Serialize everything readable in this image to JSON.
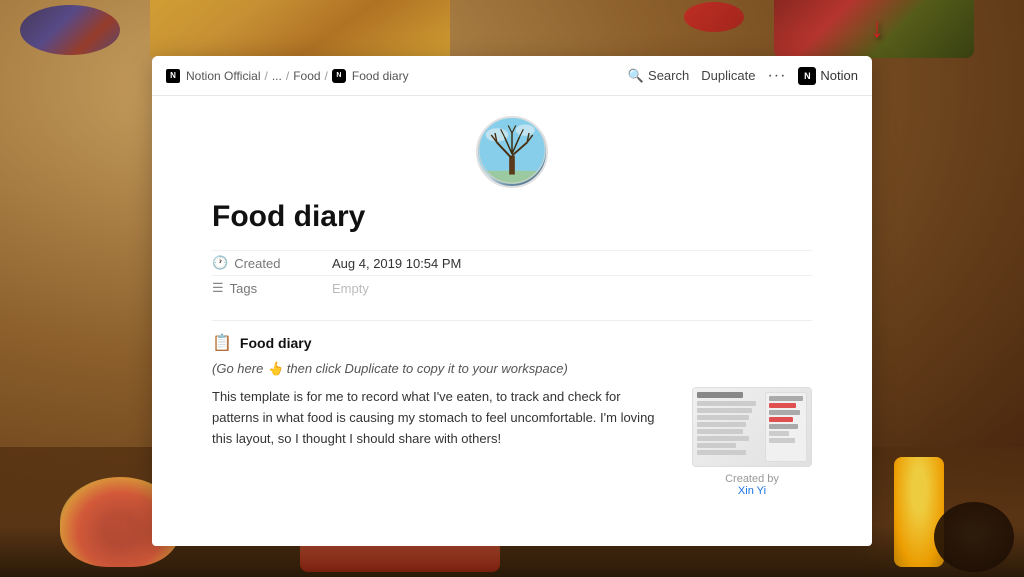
{
  "background": {
    "alt": "Food background image"
  },
  "arrow": {
    "symbol": "↓",
    "color": "#cc2222"
  },
  "topbar": {
    "notion_icon": "N",
    "breadcrumb": [
      {
        "label": "Notion Official",
        "href": "#"
      },
      {
        "label": "...",
        "href": "#"
      },
      {
        "label": "Food",
        "href": "#"
      },
      {
        "label": "Food diary",
        "href": "#"
      }
    ],
    "search_label": "Search",
    "duplicate_label": "Duplicate",
    "more_label": "···",
    "notion_label": "Notion"
  },
  "page": {
    "avatar_alt": "Tree in winter against blue sky",
    "title": "Food diary",
    "meta": {
      "created_label": "Created",
      "created_value": "Aug 4, 2019 10:54 PM",
      "tags_label": "Tags",
      "tags_value": "Empty"
    },
    "section": {
      "icon": "📋",
      "heading": "Food diary",
      "subtitle_pre": "(Go here",
      "subtitle_hand": "👆",
      "subtitle_post": "then click Duplicate to copy it to your workspace)",
      "description": "This template is for me to record what I've eaten, to track and check for patterns in what food is causing my stomach to feel uncomfortable. I'm loving this layout, so I thought I should share with others!"
    },
    "preview": {
      "created_by_label": "Created by",
      "creator_name": "Xin Yi"
    }
  }
}
